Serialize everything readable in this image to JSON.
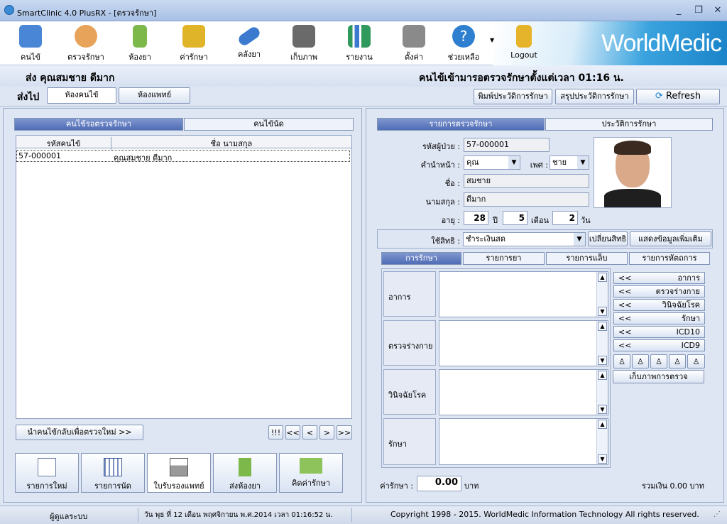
{
  "window": {
    "title": "SmartClinic 4.0 PlusRX - [ตรวจรักษา]",
    "min": "_",
    "max": "❐",
    "close": "✕"
  },
  "toolbar": [
    {
      "label": "คนไข้",
      "icon": "book-icon",
      "color": "#4a86d6"
    },
    {
      "label": "ตรวจรักษา",
      "icon": "doctor-icon",
      "color": "#e8a35a"
    },
    {
      "label": "ห้องยา",
      "icon": "medicine-bottle-icon",
      "color": "#7cb84a"
    },
    {
      "label": "ค่ารักษา",
      "icon": "money-icon",
      "color": "#e0b428"
    },
    {
      "label": "คลังยา",
      "icon": "pill-icon",
      "color": "#3c7ad0"
    },
    {
      "label": "เก็บภาพ",
      "icon": "camera-icon",
      "color": "#6a6a6a"
    },
    {
      "label": "รายงาน",
      "icon": "bar-chart-icon",
      "color": "#2f9a5b"
    },
    {
      "label": "ตั้งค่า",
      "icon": "tools-icon",
      "color": "#8a8a8a"
    },
    {
      "label": "ช่วยเหลือ",
      "icon": "help-icon",
      "color": "#2e7fd0"
    },
    {
      "label": "Logout",
      "icon": "lock-icon",
      "color": "#e6b42a"
    }
  ],
  "brand": "WorldMedic",
  "patient_header": {
    "name": "ส่ง  คุณสมชาย ดีมาก",
    "wait": "คนไข้เข้ามารอตรวจรักษาตั้งแต่เวลา 01:16 น."
  },
  "send": {
    "label": "ส่งไป",
    "btn1": "ห้องคนไข้",
    "btn2": "ห้องแพทย์",
    "print": "พิมพ์ประวัติการรักษา",
    "summary": "สรุปประวัติการรักษา",
    "refresh": "Refresh"
  },
  "left": {
    "tab1": "คนไข้รอตรวจรักษา",
    "tab2": "คนไข้นัด",
    "col1": "รหัสคนไข้",
    "col2": "ชื่อ นามสกุล",
    "rows": [
      {
        "id": "57-000001",
        "name": "คุณสมชาย ดีมาก"
      }
    ],
    "return_btn": "นำคนไข้กลับเพื่อตรวจใหม่ >>",
    "nav": [
      "!!!",
      "<<",
      "<",
      ">",
      ">>"
    ]
  },
  "bottom_buttons": [
    {
      "label": "รายการใหม่",
      "icon": "new-document-icon"
    },
    {
      "label": "รายการนัด",
      "icon": "calendar-icon"
    },
    {
      "label": "ใบรับรองแพทย์",
      "icon": "printer-icon"
    },
    {
      "label": "ส่งห้องยา",
      "icon": "medicine-bottle-icon"
    },
    {
      "label": "คิดค่ารักษา",
      "icon": "money-icon"
    }
  ],
  "right": {
    "tab1": "รายการตรวจรักษา",
    "tab2": "ประวัติการรักษา",
    "hn_label": "รหัสผู้ป่วย :",
    "hn": "57-000001",
    "prefix_label": "คำนำหน้า :",
    "prefix": "คุณ",
    "sex_label": "เพศ :",
    "sex": "ชาย",
    "fname_label": "ชื่อ :",
    "fname": "สมชาย",
    "lname_label": "นามสกุล :",
    "lname": "ดีมาก",
    "age_label": "อายุ :",
    "age_y": "28",
    "y_unit": "ปี",
    "age_m": "5",
    "m_unit": "เดือน",
    "age_d": "2",
    "d_unit": "วัน",
    "right_label": "ใช้สิทธิ :",
    "right_value": "ชำระเงินสด",
    "change_right": "เปลี่ยนสิทธิ",
    "more_info": "แสดงข้อมูลเพิ่มเติม",
    "subtabs": [
      "การรักษา",
      "รายการยา",
      "รายการแล็บ",
      "รายการหัตถการ"
    ],
    "sections": [
      "อาการ",
      "ตรวจร่างกาย",
      "วินิจฉัยโรค",
      "รักษา"
    ],
    "side_buttons": [
      "อาการ",
      "ตรวจร่างกาย",
      "วินิจฉัยโรค",
      "รักษา",
      "ICD10",
      "ICD9"
    ],
    "side_arrow": "<<",
    "photo_btn": "เก็บภาพการตรวจ",
    "fee_label": "ค่ารักษา :",
    "fee": "0.00",
    "fee_unit": "บาท",
    "total": "รวมเงิน 0.00 บาท"
  },
  "status": {
    "user": "ผู้ดูแลระบบ",
    "datetime": "วัน พุธ ที่ 12 เดือน พฤศจิกายน พ.ศ.2014 เวลา 01:16:52 น.",
    "copyright": "Copyright 1998 - 2015. WorldMedic Information  Technology All rights reserved."
  }
}
